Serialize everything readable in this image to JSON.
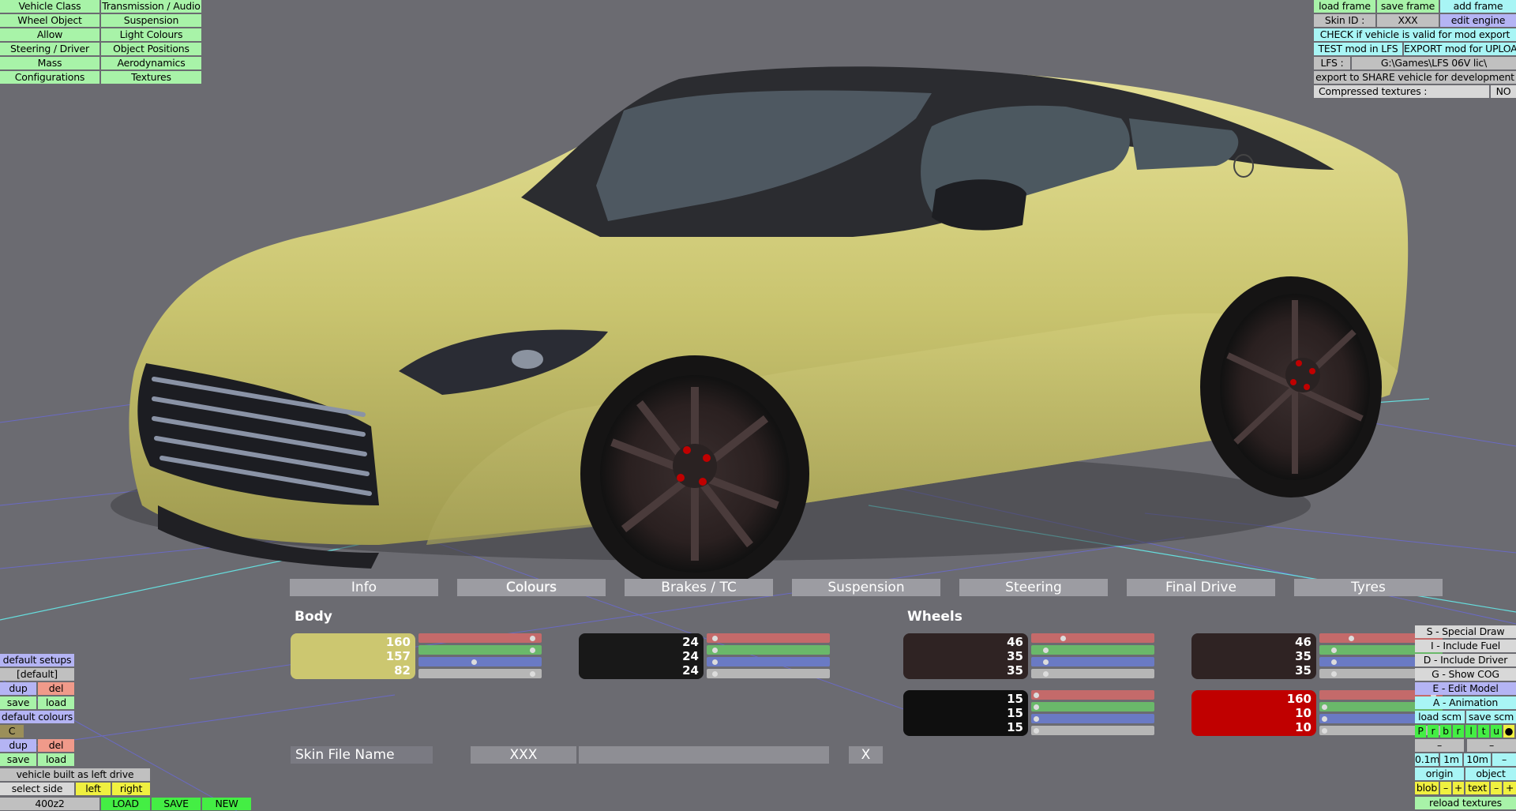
{
  "top_left_menu": [
    [
      "Vehicle Class",
      "Transmission / Audio"
    ],
    [
      "Wheel Object",
      "Suspension"
    ],
    [
      "Allow",
      "Light Colours"
    ],
    [
      "Steering / Driver",
      "Object Positions"
    ],
    [
      "Mass",
      "Aerodynamics"
    ],
    [
      "Configurations",
      "Textures"
    ]
  ],
  "top_right": {
    "load_frame": "load frame",
    "save_frame": "save frame",
    "add_frame": "add frame",
    "skin_id_label": "Skin ID :",
    "skin_id_value": "XXX",
    "edit_engine": "edit engine",
    "check_valid": "CHECK if vehicle is valid for mod export",
    "test_mod": "TEST mod in LFS",
    "export_mod": "EXPORT mod for UPLOAD",
    "lfs_label": "LFS :",
    "lfs_path": "G:\\Games\\LFS 06V lic\\",
    "export_share": "export to SHARE vehicle for development",
    "compressed_label": "Compressed textures :",
    "compressed_value": "NO"
  },
  "tabs": [
    "Info",
    "Colours",
    "Brakes / TC",
    "Suspension",
    "Steering",
    "Final Drive",
    "Tyres"
  ],
  "active_tab": "Colours",
  "body_label": "Body",
  "wheels_label": "Wheels",
  "colours": {
    "body_main": {
      "r": "160",
      "g": "157",
      "b": "82",
      "hex": "#ccc770",
      "knobs": [
        0.95,
        0.95,
        0.45,
        0.95
      ]
    },
    "body_second": {
      "r": "24",
      "g": "24",
      "b": "24",
      "hex": "#181818",
      "knobs": [
        0.05,
        0.05,
        0.05,
        0.05
      ]
    },
    "wheel_a": {
      "r": "46",
      "g": "35",
      "b": "35",
      "hex": "#2f2323",
      "knobs": [
        0.25,
        0.1,
        0.1,
        0.1
      ]
    },
    "wheel_b": {
      "r": "46",
      "g": "35",
      "b": "35",
      "hex": "#2f2323",
      "knobs": [
        0.25,
        0.1,
        0.1,
        0.1
      ]
    },
    "wheel_c": {
      "r": "15",
      "g": "15",
      "b": "15",
      "hex": "#0f0f0f",
      "knobs": [
        0.02,
        0.02,
        0.02,
        0.02
      ]
    },
    "wheel_d": {
      "r": "160",
      "g": "10",
      "b": "10",
      "hex": "#c00000",
      "knobs": [
        0.95,
        0.02,
        0.02,
        0.02
      ]
    }
  },
  "skin": {
    "label": "Skin File Name",
    "value": "XXX",
    "close": "X"
  },
  "bottom_left": {
    "default_setups": "default setups",
    "default_bracket": "[default]",
    "dup": "dup",
    "del": "del",
    "save": "save",
    "load": "load",
    "default_colours": "default colours",
    "c": "C",
    "built_as": "vehicle built as left drive",
    "select_side": "select side",
    "left": "left",
    "right": "right",
    "model": "400z2",
    "load_btn": "LOAD",
    "save_btn": "SAVE",
    "new_btn": "NEW"
  },
  "bottom_right": {
    "special_draw": "S - Special Draw",
    "include_fuel": "I - Include Fuel",
    "include_driver": "D - Include Driver",
    "show_cog": "G - Show COG",
    "edit_model": "E - Edit Model",
    "animation": "A - Animation",
    "load_scm": "load scm",
    "save_scm": "save scm",
    "letters": [
      "P",
      "r",
      "b",
      "r",
      "l",
      "t",
      "u",
      "●"
    ],
    "minus": "–",
    "step_01": "0.1m",
    "step_1": "1m",
    "step_10": "10m",
    "origin": "origin",
    "object": "object",
    "blob": "blob",
    "text": "text",
    "plus": "+",
    "reload_textures": "reload textures"
  }
}
